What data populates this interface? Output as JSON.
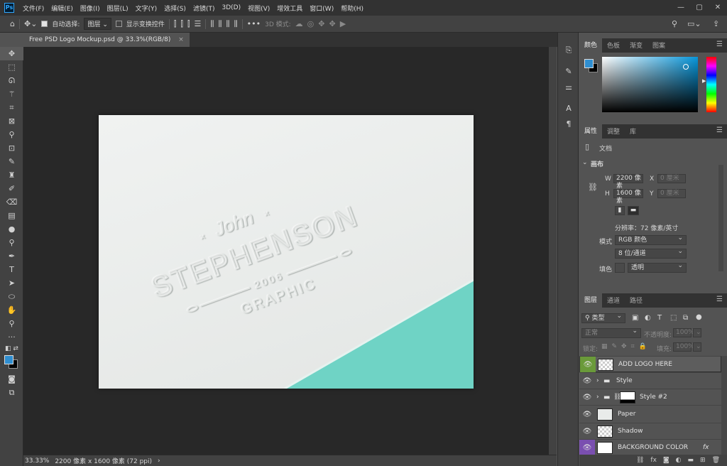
{
  "app": {
    "logo": "Ps",
    "menu": [
      "文件(F)",
      "编辑(E)",
      "图像(I)",
      "图层(L)",
      "文字(Y)",
      "选择(S)",
      "滤镜(T)",
      "3D(D)",
      "视图(V)",
      "增效工具",
      "窗口(W)",
      "帮助(H)"
    ],
    "window_controls": [
      "—",
      "▢",
      "✕"
    ]
  },
  "options": {
    "auto_select_label": "自动选择:",
    "auto_select_target": "图层",
    "show_transform_label": "显示变换控件",
    "mode_3d_label": "3D 模式:"
  },
  "document": {
    "tab_title": "Free PSD Logo Mockup.psd @ 33.3%(RGB/8)",
    "tab_close": "×",
    "zoom": "33.33%",
    "size_info": "2200 像素 x 1600 像素 (72 ppi)",
    "status_arrow": "›"
  },
  "artwork": {
    "first_name": "John",
    "name": "STEPHENSON",
    "year": "2006",
    "tagline": "GRAPHIC"
  },
  "color_panel": {
    "tabs": [
      "颜色",
      "色板",
      "渐变",
      "图案"
    ],
    "foreground": "#2f8ed0",
    "background": "#000000",
    "hue_base": "#0896da"
  },
  "properties_panel": {
    "tabs": [
      "属性",
      "调整",
      "库"
    ],
    "doc_label": "文档",
    "section": "画布",
    "w_label": "W",
    "w_value": "2200 像素",
    "h_label": "H",
    "h_value": "1600 像素",
    "x_label": "X",
    "x_value": "0 厘米",
    "y_label": "Y",
    "y_value": "0 厘米",
    "resolution": "分辨率：72 像素/英寸",
    "mode_label": "模式",
    "mode_value": "RGB 颜色",
    "bit_depth": "8 位/通道",
    "fill_label": "填色",
    "fill_value": "透明"
  },
  "layers_panel": {
    "tabs": [
      "图层",
      "通道",
      "路径"
    ],
    "filter_kind": "类型",
    "blend_mode": "正常",
    "opacity_label": "不透明度:",
    "opacity_value": "100%",
    "lock_label": "锁定:",
    "fill_label": "填充:",
    "fill_value": "100%",
    "layers": [
      {
        "name": "ADD LOGO HERE",
        "eye_color": "#6a9a3a"
      },
      {
        "name": "Style"
      },
      {
        "name": "Style #2"
      },
      {
        "name": "Paper"
      },
      {
        "name": "Shadow"
      },
      {
        "name": "BACKGROUND COLOR",
        "eye_color": "#7a4fb0"
      }
    ],
    "fx_label": "fx"
  },
  "colors": {
    "teal_panel": "#6fd3c5"
  }
}
